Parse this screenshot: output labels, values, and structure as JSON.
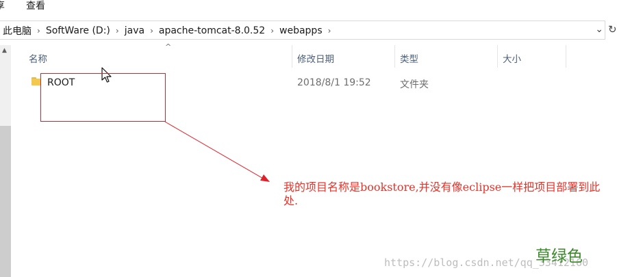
{
  "menu": {
    "cut_item": "享",
    "view_item": "查看"
  },
  "address": {
    "crumbs": [
      "此电脑",
      "SoftWare (D:)",
      "java",
      "apache-tomcat-8.0.52",
      "webapps"
    ],
    "separator": "›",
    "dropdown_glyph": "⌄",
    "refresh_glyph": "↻"
  },
  "columns": {
    "name": "名称",
    "modified": "修改日期",
    "type": "类型",
    "size": "大小",
    "sort_glyph": "^"
  },
  "files": [
    {
      "name": "ROOT",
      "modified": "2018/8/1 19:52",
      "type": "文件夹",
      "icon": "folder-icon"
    }
  ],
  "annotation": {
    "text": "我的项目名称是bookstore,并没有像eclipse一样把项目部署到此处.",
    "color": "#e83228"
  },
  "brand": {
    "text": "草绿色",
    "color": "#3a8a2a"
  },
  "watermark": {
    "text": "https://blog.csdn.net/qq_33412160"
  },
  "colors": {
    "header_text": "#4c607a",
    "folder": "#f2c94c",
    "annotation_red": "#e0202a"
  }
}
